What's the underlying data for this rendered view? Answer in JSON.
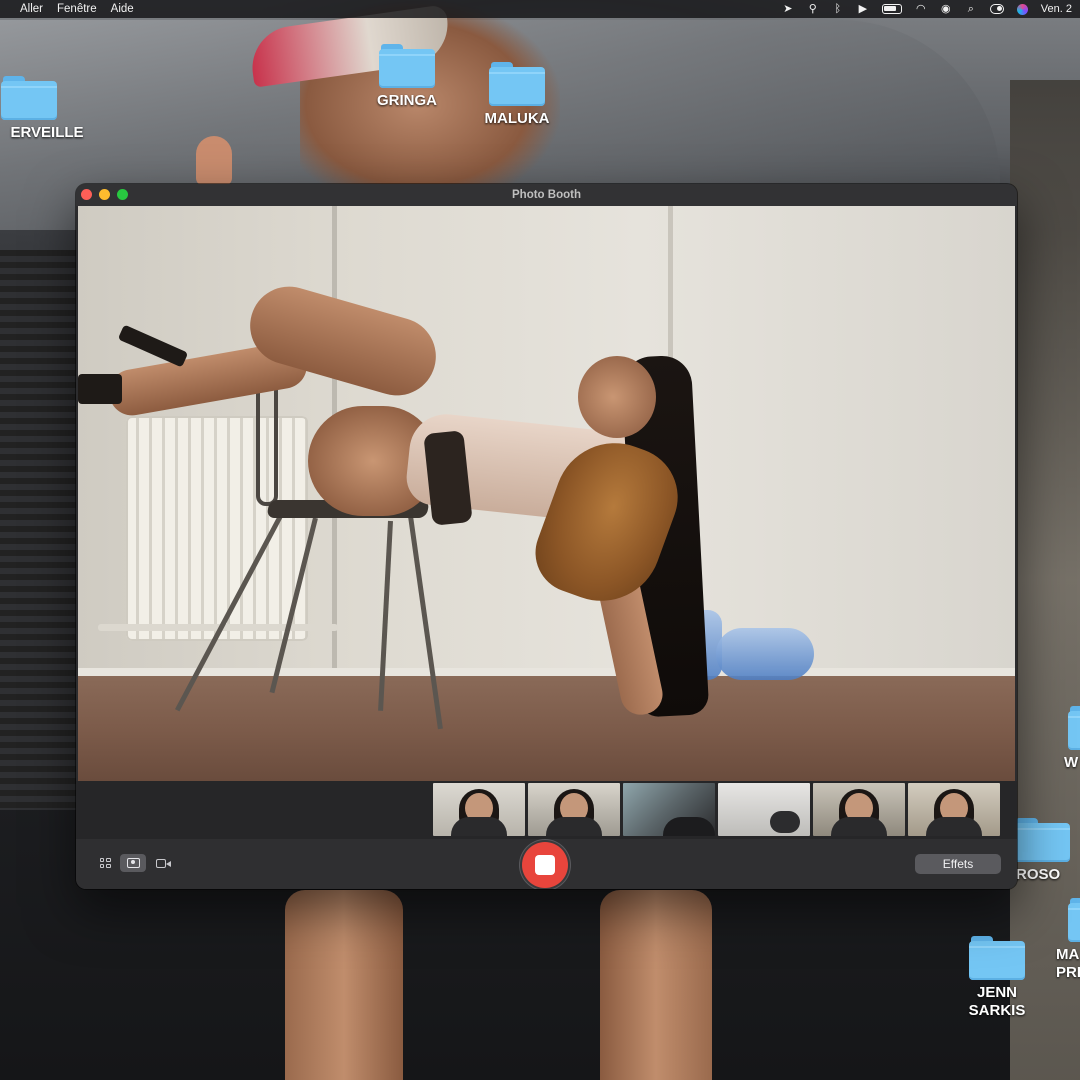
{
  "menubar": {
    "menus": [
      "Aller",
      "Fenêtre",
      "Aide"
    ],
    "clock": "Ven. 2"
  },
  "desktop": {
    "icons": [
      {
        "label": "ERVEILLE"
      },
      {
        "label": "GRINGA"
      },
      {
        "label": "MALUKA"
      },
      {
        "label": "W"
      },
      {
        "label": "ROSO"
      },
      {
        "label": "MA\nPRI"
      },
      {
        "label": "JENN\nSARKIS"
      }
    ]
  },
  "window": {
    "title": "Photo Booth",
    "effects_label": "Effets",
    "thumbnails_count": 6
  }
}
